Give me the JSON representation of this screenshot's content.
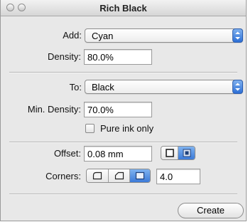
{
  "window": {
    "title": "Rich Black"
  },
  "add": {
    "label": "Add:",
    "value": "Cyan"
  },
  "density": {
    "label": "Density:",
    "value": "80.0%"
  },
  "to": {
    "label": "To:",
    "value": "Black"
  },
  "min_density": {
    "label": "Min. Density:",
    "value": "70.0%"
  },
  "pure_ink": {
    "label": "Pure ink only",
    "checked": false
  },
  "offset": {
    "label": "Offset:",
    "value": "0.08 mm",
    "selected_mode": 1
  },
  "corners": {
    "label": "Corners:",
    "selected_index": 2,
    "value": "4.0"
  },
  "actions": {
    "create_label": "Create"
  },
  "colors": {
    "accent": "#3c7ad8",
    "window_bg": "#e8e8e8"
  }
}
